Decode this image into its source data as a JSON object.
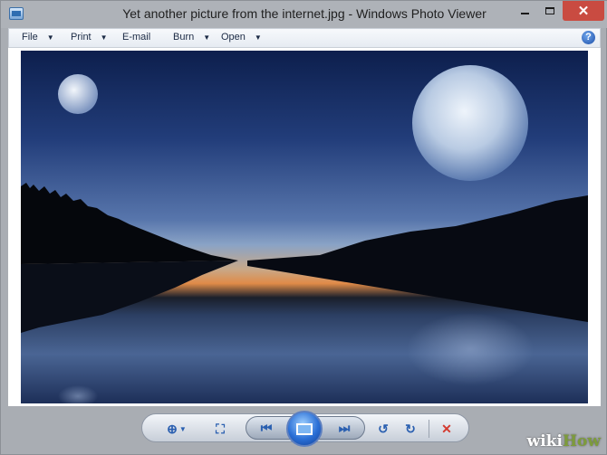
{
  "window": {
    "title": "Yet another picture from the internet.jpg - Windows Photo Viewer",
    "close_glyph": "✕"
  },
  "menu": {
    "items": [
      {
        "label": "File",
        "has_dropdown": true
      },
      {
        "label": "Print",
        "has_dropdown": true
      },
      {
        "label": "E-mail",
        "has_dropdown": false
      },
      {
        "label": "Burn",
        "has_dropdown": true
      },
      {
        "label": "Open",
        "has_dropdown": true
      }
    ],
    "help_glyph": "?"
  },
  "controls": {
    "zoom_glyph": "⊕",
    "fit_glyph": "⛶",
    "prev_glyph": "⏮",
    "next_glyph": "⏭",
    "rotate_ccw_glyph": "↺",
    "rotate_cw_glyph": "↻",
    "delete_glyph": "✕"
  },
  "watermark": {
    "prefix": "wiki",
    "suffix": "How"
  },
  "colors": {
    "close_button": "#c94b41",
    "accent_blue": "#2a6fd6",
    "delete_red": "#d43a2f"
  }
}
